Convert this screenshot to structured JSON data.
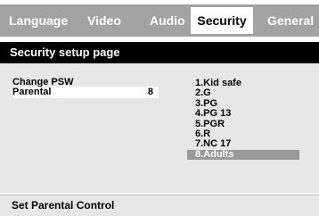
{
  "tabs": [
    {
      "label": "Language"
    },
    {
      "label": "Video"
    },
    {
      "label": "Audio"
    },
    {
      "label": "Security"
    },
    {
      "label": "General"
    }
  ],
  "active_tab": "Security",
  "page_title": "Security setup page",
  "options": [
    {
      "label": "Change PSW",
      "value": ""
    },
    {
      "label": "Parental",
      "value": "8"
    }
  ],
  "parental_levels": [
    {
      "label": "1.Kid safe"
    },
    {
      "label": "2.G"
    },
    {
      "label": "3.PG"
    },
    {
      "label": "4.PG 13"
    },
    {
      "label": "5.PGR"
    },
    {
      "label": "6.R"
    },
    {
      "label": "7.NC 17"
    },
    {
      "label": "8.Adults"
    }
  ],
  "selected_level": "8.Adults",
  "status_text": "Set Parental Control",
  "colors": {
    "tab_bar": "#a2a2a2",
    "header": "#000000",
    "panel": "#e7e7e7",
    "selection": "#999999"
  }
}
